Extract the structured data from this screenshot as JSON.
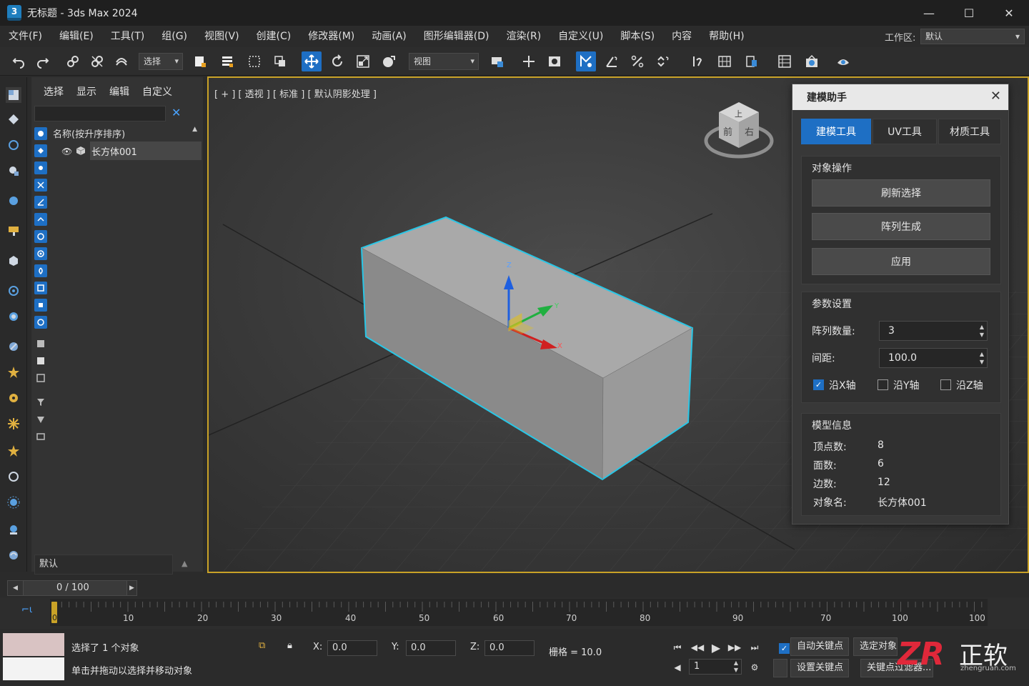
{
  "app": {
    "title": "无标题 - 3ds Max 2024",
    "logo_text": "3"
  },
  "menu": [
    "文件(F)",
    "编辑(E)",
    "工具(T)",
    "组(G)",
    "视图(V)",
    "创建(C)",
    "修改器(M)",
    "动画(A)",
    "图形编辑器(D)",
    "渲染(R)",
    "自定义(U)",
    "脚本(S)",
    "内容",
    "帮助(H)"
  ],
  "workspace": {
    "label": "工作区:",
    "value": "默认"
  },
  "toolbar": {
    "selection_filter": "选择",
    "reference_coord": "视图"
  },
  "explorer": {
    "tabs": [
      "选择",
      "显示",
      "编辑",
      "自定义"
    ],
    "column_header": "名称(按升序排序)",
    "rows": [
      {
        "label": "长方体001"
      }
    ],
    "layer": "默认"
  },
  "viewport": {
    "label": "[ + ] [ 透视 ] [ 标准 ] [ 默认阴影处理 ]",
    "viewcube": {
      "top": "上",
      "front": "前",
      "right": "右"
    },
    "gizmo": {
      "x": "X",
      "y": "Y",
      "z": "Z"
    }
  },
  "helper": {
    "title": "建模助手",
    "tabs": [
      "建模工具",
      "UV工具",
      "材质工具"
    ],
    "active_tab": 0,
    "object_ops": {
      "title": "对象操作",
      "buttons": [
        "刷新选择",
        "阵列生成",
        "应用"
      ]
    },
    "params": {
      "title": "参数设置",
      "array_count_label": "阵列数量:",
      "array_count": "3",
      "spacing_label": "间距:",
      "spacing": "100.0",
      "axis_x": "沿X轴",
      "axis_y": "沿Y轴",
      "axis_z": "沿Z轴",
      "axis_x_checked": true,
      "axis_y_checked": false,
      "axis_z_checked": false
    },
    "info": {
      "title": "模型信息",
      "vertices_label": "顶点数:",
      "vertices": "8",
      "faces_label": "面数:",
      "faces": "6",
      "edges_label": "边数:",
      "edges": "12",
      "name_label": "对象名:",
      "name": "长方体001"
    }
  },
  "time_slider": {
    "text": "0  /  100"
  },
  "timeline": {
    "current_frame": "0",
    "labels": [
      "10",
      "20",
      "30",
      "40",
      "50",
      "60",
      "70",
      "80",
      "90",
      "70",
      "100",
      "100"
    ]
  },
  "status": {
    "selected": "选择了 1 个对象",
    "prompt": "单击并拖动以选择并移动对象",
    "x_label": "X:",
    "x": "0.0",
    "y_label": "Y:",
    "y": "0.0",
    "z_label": "Z:",
    "z": "0.0",
    "grid": "栅格 = 10.0",
    "frame": "1",
    "auto_key": "自动关键点",
    "auto_key_checked": true,
    "selected_obj": "选定对象",
    "set_key": "设置关键点",
    "key_filter": "关键点过滤器..."
  },
  "watermark": {
    "logo": "ZR",
    "name": "正软",
    "url": "zhengruan.com"
  },
  "colors": {
    "accent": "#1e6fc4",
    "viewport_border": "#c9a227",
    "selection_outline": "#29c6e6"
  }
}
